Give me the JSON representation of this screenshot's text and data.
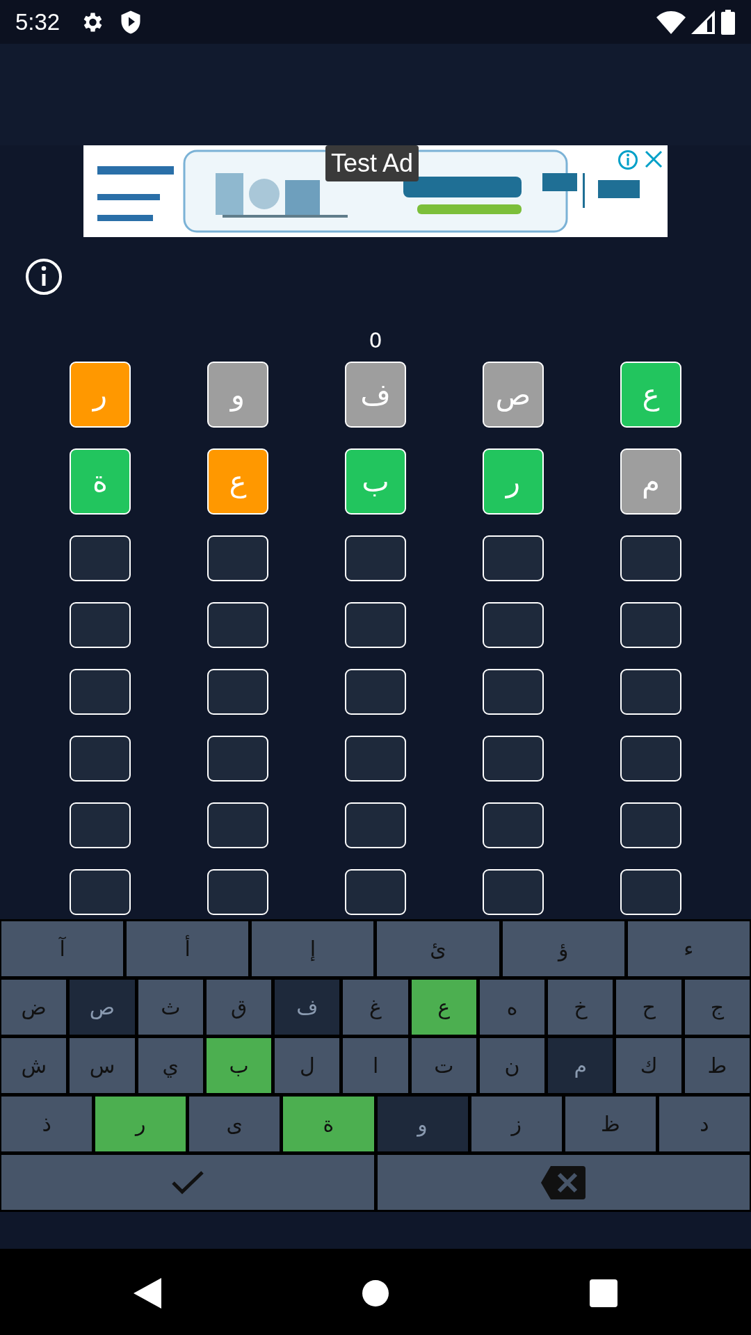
{
  "status_bar": {
    "time": "5:32"
  },
  "ad": {
    "label": "Test Ad"
  },
  "score": "0",
  "grid": [
    [
      {
        "letter": "ع",
        "color": "#22c55e"
      },
      {
        "letter": "ص",
        "color": "#9e9e9e"
      },
      {
        "letter": "ف",
        "color": "#9e9e9e"
      },
      {
        "letter": "و",
        "color": "#9e9e9e"
      },
      {
        "letter": "ر",
        "color": "#ff9800"
      }
    ],
    [
      {
        "letter": "م",
        "color": "#9e9e9e"
      },
      {
        "letter": "ر",
        "color": "#22c55e"
      },
      {
        "letter": "ب",
        "color": "#22c55e"
      },
      {
        "letter": "ع",
        "color": "#ff9800"
      },
      {
        "letter": "ة",
        "color": "#22c55e"
      }
    ],
    [
      {
        "color": "#1e293b"
      },
      {
        "color": "#1e293b"
      },
      {
        "color": "#1e293b"
      },
      {
        "color": "#1e293b"
      },
      {
        "color": "#1e293b"
      }
    ],
    [
      {
        "color": "#1e293b"
      },
      {
        "color": "#1e293b"
      },
      {
        "color": "#1e293b"
      },
      {
        "color": "#1e293b"
      },
      {
        "color": "#1e293b"
      }
    ],
    [
      {
        "color": "#1e293b"
      },
      {
        "color": "#1e293b"
      },
      {
        "color": "#1e293b"
      },
      {
        "color": "#1e293b"
      },
      {
        "color": "#1e293b"
      }
    ],
    [
      {
        "color": "#1e293b"
      },
      {
        "color": "#1e293b"
      },
      {
        "color": "#1e293b"
      },
      {
        "color": "#1e293b"
      },
      {
        "color": "#1e293b"
      }
    ],
    [
      {
        "color": "#1e293b"
      },
      {
        "color": "#1e293b"
      },
      {
        "color": "#1e293b"
      },
      {
        "color": "#1e293b"
      },
      {
        "color": "#1e293b"
      }
    ],
    [
      {
        "color": "#1e293b"
      },
      {
        "color": "#1e293b"
      },
      {
        "color": "#1e293b"
      },
      {
        "color": "#1e293b"
      },
      {
        "color": "#1e293b"
      }
    ]
  ],
  "keyboard": [
    [
      {
        "kind": "letter",
        "label": "ء",
        "color": "#475569"
      },
      {
        "kind": "letter",
        "label": "ؤ",
        "color": "#475569"
      },
      {
        "kind": "letter",
        "label": "ئ",
        "color": "#475569"
      },
      {
        "kind": "letter",
        "label": "إ",
        "color": "#475569"
      },
      {
        "kind": "letter",
        "label": "أ",
        "color": "#475569"
      },
      {
        "kind": "letter",
        "label": "آ",
        "color": "#475569"
      }
    ],
    [
      {
        "kind": "letter",
        "label": "ج",
        "color": "#475569"
      },
      {
        "kind": "letter",
        "label": "ح",
        "color": "#475569"
      },
      {
        "kind": "letter",
        "label": "خ",
        "color": "#475569"
      },
      {
        "kind": "letter",
        "label": "ه",
        "color": "#475569"
      },
      {
        "kind": "letter",
        "label": "ع",
        "color": "#4caf50"
      },
      {
        "kind": "letter",
        "label": "غ",
        "color": "#475569"
      },
      {
        "kind": "letter",
        "label": "ف",
        "color": "#1e293b"
      },
      {
        "kind": "letter",
        "label": "ق",
        "color": "#475569"
      },
      {
        "kind": "letter",
        "label": "ث",
        "color": "#475569"
      },
      {
        "kind": "letter",
        "label": "ص",
        "color": "#1e293b"
      },
      {
        "kind": "letter",
        "label": "ض",
        "color": "#475569"
      }
    ],
    [
      {
        "kind": "letter",
        "label": "ط",
        "color": "#475569"
      },
      {
        "kind": "letter",
        "label": "ك",
        "color": "#475569"
      },
      {
        "kind": "letter",
        "label": "م",
        "color": "#1e293b"
      },
      {
        "kind": "letter",
        "label": "ن",
        "color": "#475569"
      },
      {
        "kind": "letter",
        "label": "ت",
        "color": "#475569"
      },
      {
        "kind": "letter",
        "label": "ا",
        "color": "#475569"
      },
      {
        "kind": "letter",
        "label": "ل",
        "color": "#475569"
      },
      {
        "kind": "letter",
        "label": "ب",
        "color": "#4caf50"
      },
      {
        "kind": "letter",
        "label": "ي",
        "color": "#475569"
      },
      {
        "kind": "letter",
        "label": "س",
        "color": "#475569"
      },
      {
        "kind": "letter",
        "label": "ش",
        "color": "#475569"
      }
    ],
    [
      {
        "kind": "letter",
        "label": "د",
        "color": "#475569"
      },
      {
        "kind": "letter",
        "label": "ظ",
        "color": "#475569"
      },
      {
        "kind": "letter",
        "label": "ز",
        "color": "#475569"
      },
      {
        "kind": "letter",
        "label": "و",
        "color": "#1e293b"
      },
      {
        "kind": "letter",
        "label": "ة",
        "color": "#4caf50"
      },
      {
        "kind": "letter",
        "label": "ى",
        "color": "#475569"
      },
      {
        "kind": "letter",
        "label": "ر",
        "color": "#4caf50"
      },
      {
        "kind": "letter",
        "label": "ذ",
        "color": "#475569"
      }
    ],
    [
      {
        "kind": "backspace"
      },
      {
        "kind": "enter"
      }
    ]
  ]
}
